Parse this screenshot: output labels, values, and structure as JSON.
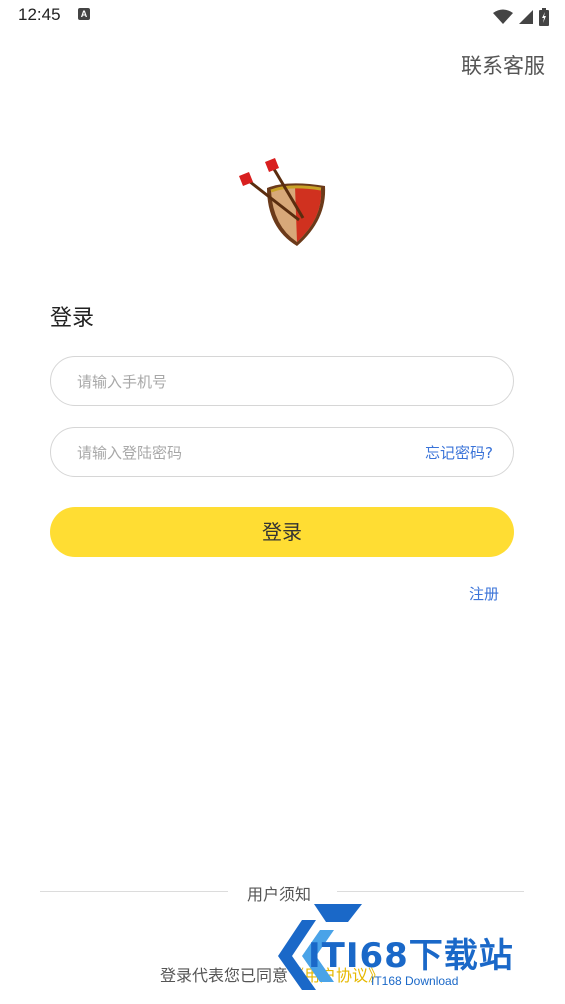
{
  "status_bar": {
    "time": "12:45",
    "notification_glyph": "A",
    "icons": [
      "wifi-icon",
      "signal-icon",
      "battery-icon"
    ]
  },
  "header": {
    "contact_label": "联系客服"
  },
  "logo": {
    "icon": "shield-arrows-logo"
  },
  "login": {
    "title": "登录",
    "phone_placeholder": "请输入手机号",
    "password_placeholder": "请输入登陆密码",
    "forgot_label": "忘记密码?",
    "submit_label": "登录",
    "register_label": "注册"
  },
  "footer": {
    "notice_title": "用户须知",
    "agreement_prefix": "登录代表您已同意",
    "agreement_link": "《用户协议》"
  },
  "watermark": {
    "main": "ITI68下载站",
    "sub": "IT168 Download"
  },
  "colors": {
    "accent": "#ffdd33",
    "link": "#3a73d8",
    "agreement_link": "#e6b800",
    "watermark": "#1a68c8"
  }
}
